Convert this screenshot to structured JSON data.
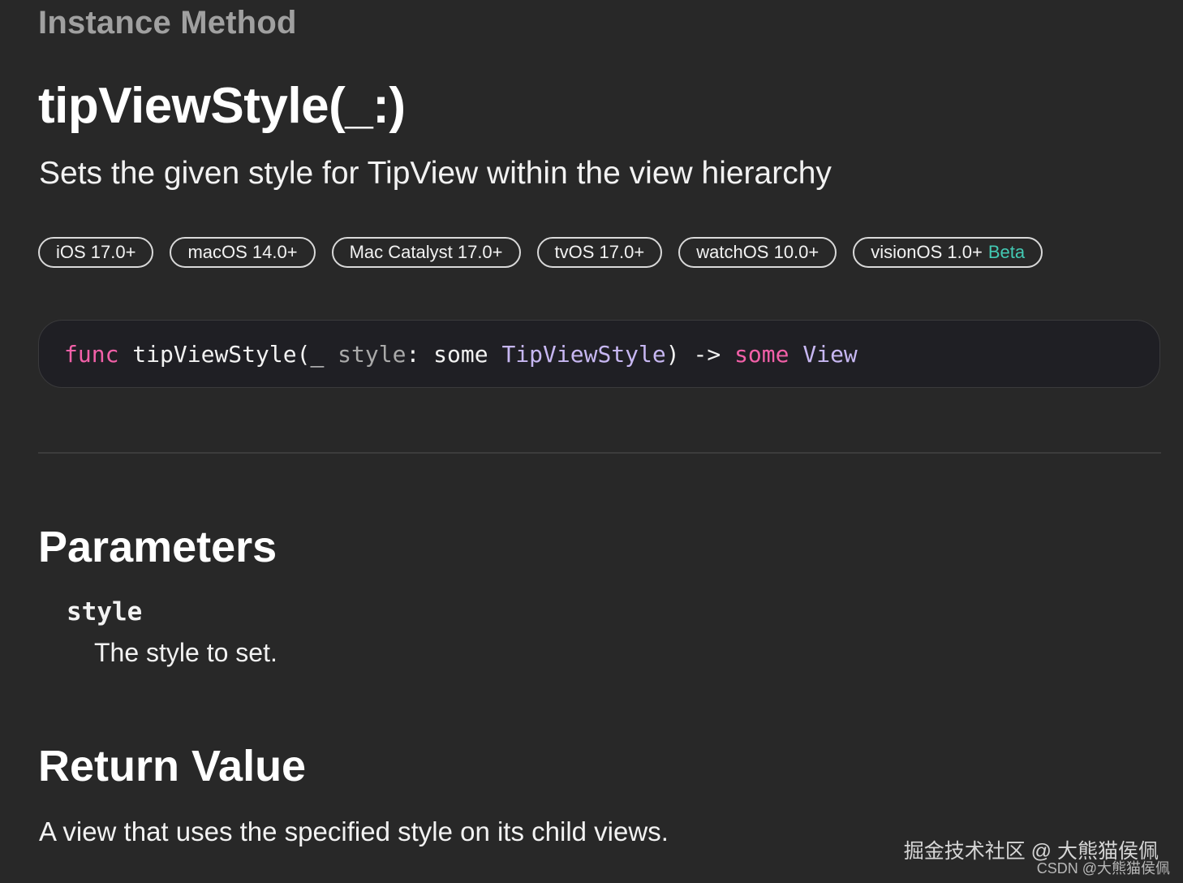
{
  "header": {
    "eyebrow": "Instance Method",
    "title": "tipViewStyle(_:)",
    "abstract": "Sets the given style for TipView within the view hierarchy"
  },
  "availability": [
    {
      "label": "iOS 17.0+",
      "beta": ""
    },
    {
      "label": "macOS 14.0+",
      "beta": ""
    },
    {
      "label": "Mac Catalyst 17.0+",
      "beta": ""
    },
    {
      "label": "tvOS 17.0+",
      "beta": ""
    },
    {
      "label": "watchOS 10.0+",
      "beta": ""
    },
    {
      "label": "visionOS 1.0+",
      "beta": "Beta"
    }
  ],
  "colors": {
    "background": "#282828",
    "keyword": "#f260a8",
    "type": "#c7b7f2",
    "beta": "#43c9b3"
  },
  "declaration": {
    "tokens": [
      {
        "text": "func",
        "kind": "keyword"
      },
      {
        "text": " tipViewStyle(_ ",
        "kind": "plain"
      },
      {
        "text": "style",
        "kind": "param"
      },
      {
        "text": ": some ",
        "kind": "plain"
      },
      {
        "text": "TipViewStyle",
        "kind": "type"
      },
      {
        "text": ") -> ",
        "kind": "plain"
      },
      {
        "text": "some",
        "kind": "keyword"
      },
      {
        "text": " ",
        "kind": "plain"
      },
      {
        "text": "View",
        "kind": "type"
      }
    ]
  },
  "parameters": {
    "heading": "Parameters",
    "items": [
      {
        "name": "style",
        "description": "The style to set."
      }
    ]
  },
  "return_value": {
    "heading": "Return Value",
    "description": "A view that uses the specified style on its child views."
  },
  "watermark": {
    "line1": "掘金技术社区 @ 大熊猫侯佩",
    "line2": "CSDN @大熊猫侯佩"
  }
}
